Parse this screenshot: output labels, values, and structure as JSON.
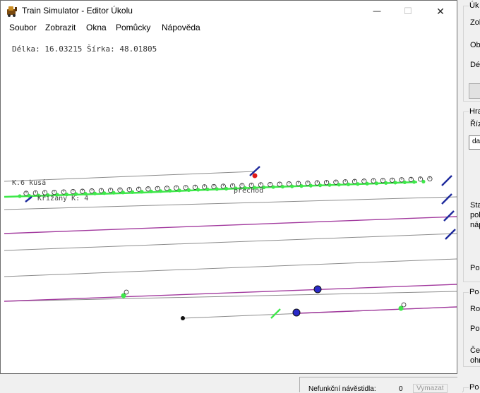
{
  "window": {
    "title": "Train Simulator - Editor Úkolu",
    "minimize_glyph": "—",
    "maximize_glyph": "☐",
    "close_glyph": "✕"
  },
  "menu": [
    "Soubor",
    "Zobrazit",
    "Okna",
    "Pomůcky",
    "Nápověda"
  ],
  "map": {
    "coords_text": "Délka: 16.03215 Šírka: 48.01805",
    "labels": {
      "kusa": "K.6 kusá",
      "krizany": "Křižany  K: 4",
      "prechod": "přechod"
    },
    "colors": {
      "track": "#8c8c8c",
      "route": "#a23a9e",
      "green": "#3ee84a",
      "signal": "#1e2a9c",
      "red": "#e01818"
    }
  },
  "right_panel": {
    "group1": {
      "legend": "Úk",
      "labels": [
        "Zol",
        "Ob",
        "Dél"
      ]
    },
    "group2": {
      "legend": "Hra",
      "labels": [
        "Říz"
      ],
      "field_value": "da",
      "labels2": [
        "Sta",
        "pol",
        "náp",
        "Po"
      ]
    },
    "group3": {
      "legend": "Po",
      "labels": [
        "Roc",
        "Po",
        "Čet",
        "ohr"
      ]
    },
    "group4": {
      "legend": "Po"
    }
  },
  "status": {
    "label": "Nefunkční návěstidla:",
    "value": "0",
    "button": "Vymazat"
  }
}
